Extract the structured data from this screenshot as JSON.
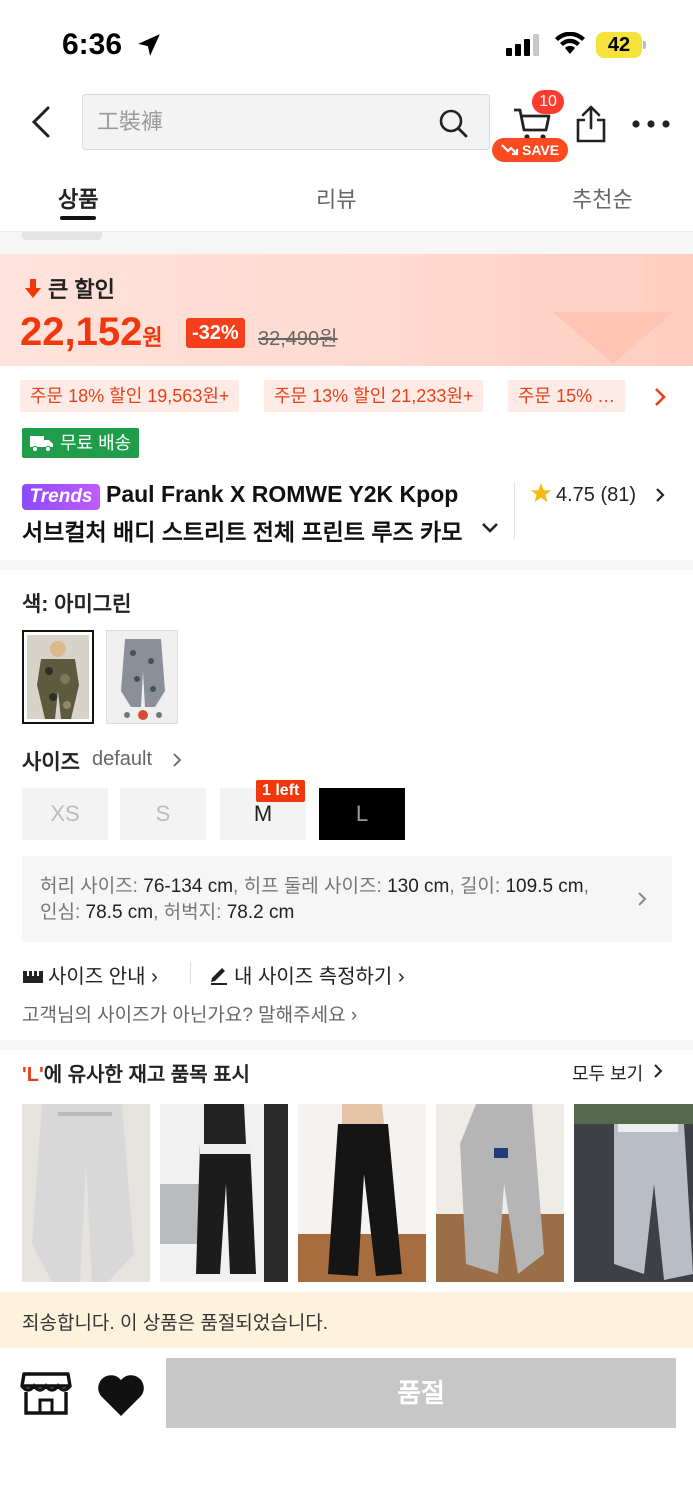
{
  "status_bar": {
    "time": "6:36",
    "battery": "42"
  },
  "header": {
    "search_placeholder": "工裝褲",
    "cart_count": "10",
    "save_label": "SAVE"
  },
  "tabs": [
    {
      "label": "상품"
    },
    {
      "label": "리뷰"
    },
    {
      "label": "추천순"
    }
  ],
  "price_banner": {
    "big_sale": "큰 할인",
    "price": "22,152",
    "currency": "원",
    "discount": "-32%",
    "original_price": "32,490원"
  },
  "promos": [
    {
      "label": "주문 18% 할인 19,563원+"
    },
    {
      "label": "주문 13% 할인 21,233원+"
    },
    {
      "label": "주문 15% …"
    }
  ],
  "free_shipping": "무료 배송",
  "product": {
    "badge": "Trends",
    "title_line1": "Paul Frank X ROMWE Y2K Kpop",
    "title_line2": "서브컬처 배디 스트리트 전체 프린트 루즈 카모",
    "rating": "4.75",
    "review_count": "(81)"
  },
  "color": {
    "label": "색:",
    "value": "아미그린"
  },
  "size": {
    "title": "사이즈",
    "default_label": "default",
    "options": [
      {
        "label": "XS"
      },
      {
        "label": "S"
      },
      {
        "label": "M"
      },
      {
        "label": "L"
      }
    ],
    "left_badge": "1 left"
  },
  "measurements": {
    "waist_label": "허리 사이즈:",
    "waist": "76-134 cm",
    "hip_label": ", 히프 둘레 사이즈:",
    "hip": "130 cm",
    "length_label": ", 길이:",
    "length": "109.5 cm",
    "inseam_label": ", 인심:",
    "inseam": "78.5 cm",
    "thigh_label": ", 허벅지:",
    "thigh": "78.2 cm"
  },
  "guide": {
    "size_guide": "사이즈 안내",
    "measure": "내 사이즈 측정하기",
    "not_size": "고객님의 사이즈가 아닌가요? 말해주세요"
  },
  "similar": {
    "quoted": "'L'",
    "title_rest": "에 유사한 재고 품목 표시",
    "see_all": "모두 보기"
  },
  "soldout_notice": "죄송합니다. 이 상품은 품절되었습니다.",
  "bottom": {
    "soldout_button": "품절"
  },
  "colors": {
    "accent": "#f0380c",
    "free_ship": "#1f9d4b",
    "trends": "#8b4bff"
  }
}
